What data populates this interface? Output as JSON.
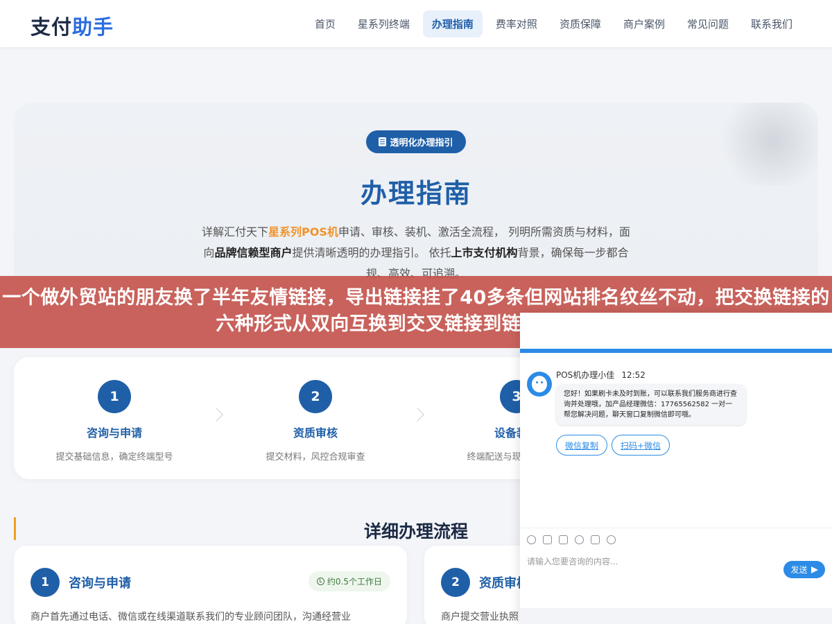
{
  "header": {
    "logo_part1": "支付",
    "logo_part2": "助手",
    "nav": [
      "首页",
      "星系列终端",
      "办理指南",
      "费率对照",
      "资质保障",
      "商户案例",
      "常见问题",
      "联系我们"
    ],
    "active_index": 2
  },
  "hero": {
    "badge": "透明化办理指引",
    "title": "办理指南",
    "desc_1": "详解汇付天下",
    "desc_hl": "星系列POS机",
    "desc_2": "申请、审核、装机、激活全流程， 列明所需资质与材料，面向",
    "desc_bd1": "品牌信赖型商户",
    "desc_3": "提供清晰透明的办理指引。 依托",
    "desc_bd2": "上市支付机构",
    "desc_4": "背景，确保每一步都合规、高效、可追溯。"
  },
  "banner": {
    "text": "一个做外贸站的朋友换了半年友情链接，导出链接挂了40多条但网站排名纹丝不动，把交换链接的六种形式从双向互换到交叉链接到链轮挨个拆开"
  },
  "steps": [
    {
      "num": "1",
      "title": "咨询与申请",
      "desc": "提交基础信息，确定终端型号"
    },
    {
      "num": "2",
      "title": "资质审核",
      "desc": "提交材料，风控合规审查"
    },
    {
      "num": "3",
      "title": "设备装机",
      "desc": "终端配送与现场安装调试"
    }
  ],
  "detail": {
    "title": "详细办理流程",
    "cards": [
      {
        "num": "1",
        "title": "咨询与申请",
        "time": "约0.5个工作日",
        "text": "商户首先通过电话、微信或在线渠道联系我们的专业顾问团队，沟通经营业"
      },
      {
        "num": "2",
        "title": "资质审核",
        "text": "商户提交营业执照"
      }
    ]
  },
  "chat": {
    "agent_name": "POS机办理小佳",
    "time": "12:52",
    "message": "您好！如果刷卡未及时到账，可以联系我们服务商进行查询并处理哦，加产品经理微信：17765562582 一对一帮您解决问题，聊天窗口复制微信即可哦。",
    "btn_copy": "微信复制",
    "btn_scan": "扫码+微信",
    "input_placeholder": "请输入您要咨询的内容...",
    "send_label": "发送",
    "brand_color": "#2b8be6"
  }
}
